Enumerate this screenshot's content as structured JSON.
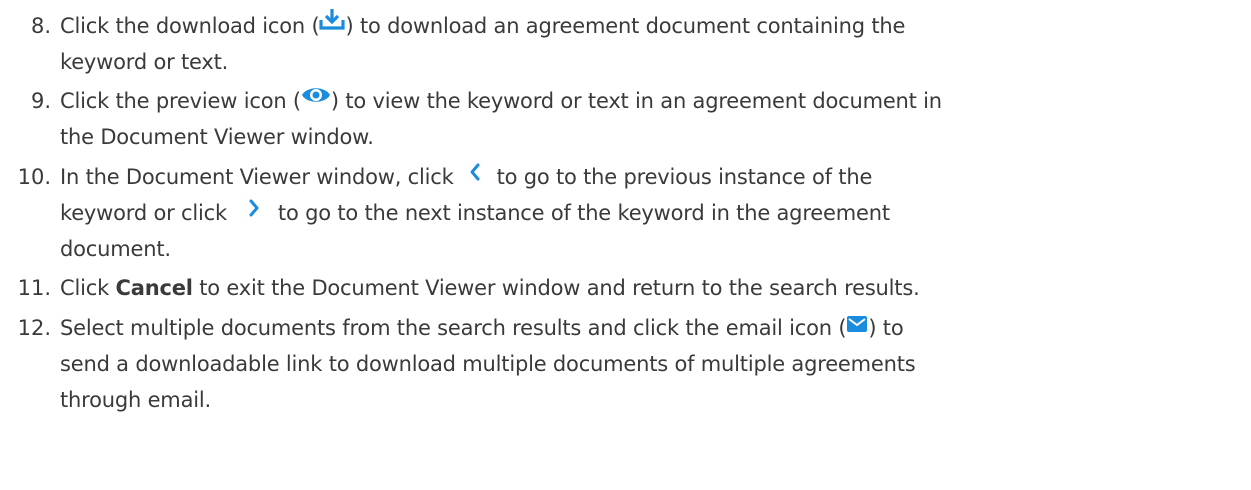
{
  "steps": [
    {
      "number": "8.",
      "lines": [
        [
          "Click the download icon (",
          ") to download an agreement document containing the"
        ],
        [
          "keyword or text."
        ]
      ],
      "icon": "download-icon"
    },
    {
      "number": "9.",
      "lines": [
        [
          "Click the preview icon (",
          ") to view the keyword or text in an agreement document in"
        ],
        [
          "the Document Viewer window."
        ]
      ],
      "icon": "eye-icon"
    },
    {
      "number": "10.",
      "lines": [
        [
          "In the Document Viewer window, click",
          "to go to the previous instance of the"
        ],
        [
          "keyword or click",
          "to go to the next instance of the keyword in the agreement"
        ],
        [
          "document."
        ]
      ],
      "icons": [
        "chevron-left-icon",
        "chevron-right-icon"
      ]
    },
    {
      "number": "11.",
      "lines": [
        [
          "Click ",
          "Cancel",
          " to exit the Document Viewer window and return to the search results."
        ]
      ]
    },
    {
      "number": "12.",
      "lines": [
        [
          "Select multiple documents from the search results and click the email icon (",
          ") to"
        ],
        [
          "send a downloadable link to download multiple documents of multiple agreements"
        ],
        [
          "through email."
        ]
      ],
      "icon": "email-icon"
    }
  ],
  "colors": {
    "text": "#3a3a3a",
    "icon_blue": "#1a8cde"
  }
}
